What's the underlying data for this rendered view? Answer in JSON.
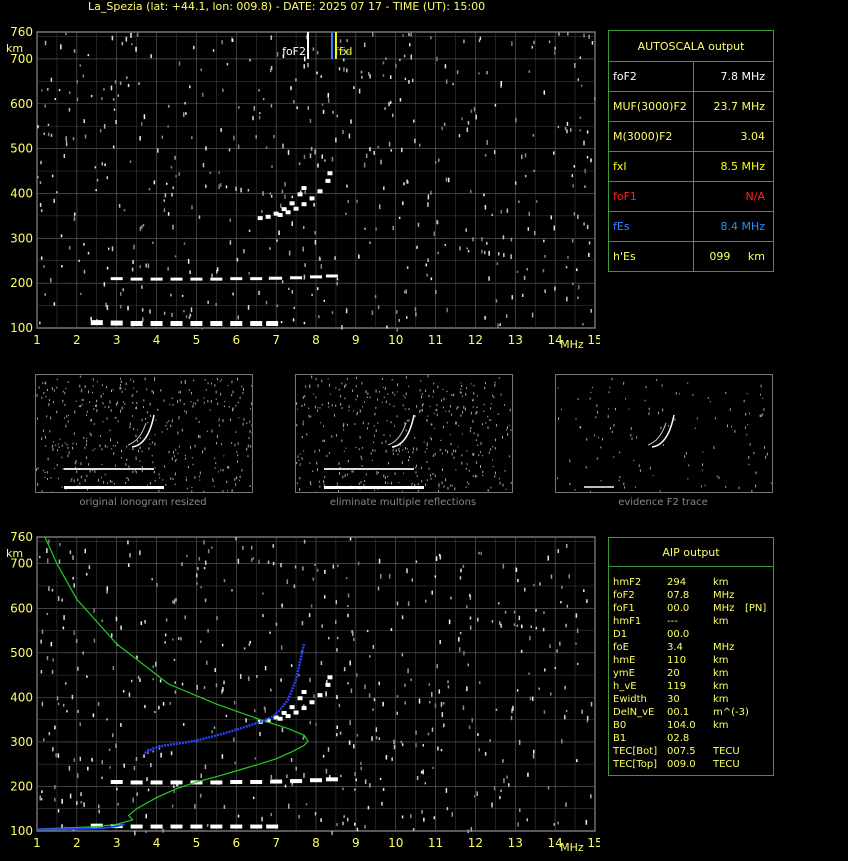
{
  "title": "La_Spezia (lat: +44.1, lon: 009.8) - DATE: 2025 07 17 - TIME (UT): 15:00",
  "colors": {
    "axis": "#ffff66",
    "grid": "#666666",
    "trace": "#ffffff",
    "profile": "#22cc22",
    "aip_points": "#2244ff",
    "foF2_marker": "#ffffff",
    "fEs_marker": "#3388ff",
    "fxI_marker": "#ffff00"
  },
  "top_chart": {
    "y_unit": "km",
    "x_unit": "MHz",
    "marker_labels": {
      "foF2": "foF2",
      "fEs": "fEs",
      "fxI": "fxI"
    }
  },
  "autoscala": {
    "title": "AUTOSCALA output",
    "rows": [
      {
        "label": "foF2",
        "value": "7.8 MHz",
        "color": "#ffffff"
      },
      {
        "label": "MUF(3000)F2",
        "value": "23.7 MHz",
        "color": "#ffff66"
      },
      {
        "label": "M(3000)F2",
        "value": "3.04",
        "color": "#ffff66"
      },
      {
        "label": "fxI",
        "value": "8.5 MHz",
        "color": "#ffff00"
      },
      {
        "label": "foF1",
        "value": "N/A",
        "color": "#ff2222"
      },
      {
        "label": "fEs",
        "value": "8.4 MHz",
        "color": "#3388ff"
      },
      {
        "label": "h'Es",
        "value": "099     km",
        "color": "#ffff66"
      }
    ]
  },
  "thumbnails": [
    {
      "caption": "original ionogram resized"
    },
    {
      "caption": "eliminate multiple reflections"
    },
    {
      "caption": "evidence F2 trace"
    }
  ],
  "bottom_chart": {
    "y_unit": "km",
    "x_unit": "MHz"
  },
  "aip": {
    "title": "AIP output",
    "rows": [
      [
        "hmF2",
        "294",
        "km",
        ""
      ],
      [
        "foF2",
        "07.8",
        "MHz",
        ""
      ],
      [
        "foF1",
        "00.0",
        "MHz",
        "[PN]"
      ],
      [
        "hmF1",
        "---",
        "km",
        ""
      ],
      [
        "D1",
        "00.0",
        "",
        ""
      ],
      [
        "foE",
        "3.4",
        "MHz",
        ""
      ],
      [
        "hmE",
        "110",
        "km",
        ""
      ],
      [
        "ymE",
        "20",
        "km",
        ""
      ],
      [
        "h_vE",
        "119",
        "km",
        ""
      ],
      [
        "Ewidth",
        "30",
        "km",
        ""
      ],
      [
        "DelN_vE",
        "00.1",
        "m^(-3)",
        ""
      ],
      [
        "B0",
        "104.0",
        "km",
        ""
      ],
      [
        "B1",
        "02.8",
        "",
        ""
      ],
      [
        "TEC[Bot]",
        "007.5",
        "TECU",
        ""
      ],
      [
        "TEC[Top]",
        "009.0",
        "TECU",
        ""
      ]
    ]
  },
  "chart_data": [
    {
      "type": "scatter",
      "title": "",
      "xlabel": "MHz",
      "ylabel": "km",
      "xlim": [
        1,
        15
      ],
      "ylim": [
        100,
        760
      ],
      "x_ticks": [
        1,
        2,
        3,
        4,
        5,
        6,
        7,
        8,
        9,
        10,
        11,
        12,
        13,
        14,
        15
      ],
      "y_ticks": [
        100,
        200,
        300,
        400,
        500,
        600,
        700,
        760
      ],
      "grid": true,
      "series": [
        {
          "name": "",
          "x": [
            2.5,
            3.0,
            3.5,
            4.0,
            4.5,
            5.0,
            5.5,
            6.0,
            6.5,
            6.9
          ],
          "y": [
            112,
            111,
            110,
            110,
            110,
            110,
            110,
            110,
            110,
            110
          ]
        },
        {
          "name": "",
          "x": [
            3.0,
            3.5,
            4.0,
            4.5,
            5.0,
            5.5,
            6.0,
            6.5,
            7.0,
            7.5,
            8.0,
            8.4
          ],
          "y": [
            210,
            209,
            209,
            209,
            209,
            209,
            210,
            210,
            211,
            212,
            214,
            216
          ]
        },
        {
          "name": "",
          "x": [
            7.1,
            7.3,
            7.5,
            7.7,
            7.9,
            8.1,
            8.3,
            8.35
          ],
          "y": [
            352,
            358,
            366,
            376,
            389,
            405,
            428,
            445
          ]
        },
        {
          "name": "",
          "x": [
            6.6,
            6.8,
            7.0,
            7.2,
            7.4,
            7.6,
            7.7
          ],
          "y": [
            345,
            348,
            355,
            365,
            378,
            398,
            412
          ]
        }
      ],
      "markers": [
        {
          "name": "foF2",
          "x": 7.8
        },
        {
          "name": "fEs",
          "x": 8.4
        },
        {
          "name": "fxI",
          "x": 8.5
        }
      ]
    },
    {
      "type": "line",
      "title": "",
      "xlabel": "MHz",
      "ylabel": "km",
      "xlim": [
        1,
        15
      ],
      "ylim": [
        100,
        760
      ],
      "x_ticks": [
        1,
        2,
        3,
        4,
        5,
        6,
        7,
        8,
        9,
        10,
        11,
        12,
        13,
        14,
        15
      ],
      "y_ticks": [
        100,
        200,
        300,
        400,
        500,
        600,
        700,
        760
      ],
      "grid": true,
      "series": [
        {
          "name": "",
          "x": [
            1.1,
            1.5,
            2.0,
            2.5,
            3.0,
            3.4,
            3.3,
            3.5,
            4.0,
            4.5,
            5.0,
            5.5,
            6.0,
            6.5,
            7.0,
            7.4,
            7.7,
            7.8,
            7.7,
            7.3,
            6.6,
            5.5,
            4.3,
            3.0,
            2.0,
            1.5,
            1.2
          ],
          "y": [
            105,
            106,
            108,
            110,
            115,
            125,
            135,
            150,
            175,
            195,
            210,
            222,
            235,
            248,
            262,
            278,
            292,
            302,
            315,
            330,
            350,
            385,
            430,
            520,
            620,
            700,
            760
          ]
        },
        {
          "name": "",
          "x": [
            3.7,
            3.9,
            4.2,
            4.6,
            5.0,
            5.4,
            5.8,
            6.2,
            6.6,
            6.9,
            7.1,
            7.3,
            7.5,
            7.7
          ],
          "y": [
            275,
            285,
            292,
            297,
            303,
            312,
            322,
            333,
            345,
            356,
            372,
            395,
            440,
            520
          ]
        },
        {
          "name": "",
          "x": [
            1.0,
            1.5,
            2.0,
            2.5,
            2.8,
            3.0,
            3.2
          ],
          "y": [
            104,
            104,
            105,
            106,
            108,
            111,
            115
          ]
        }
      ]
    }
  ]
}
